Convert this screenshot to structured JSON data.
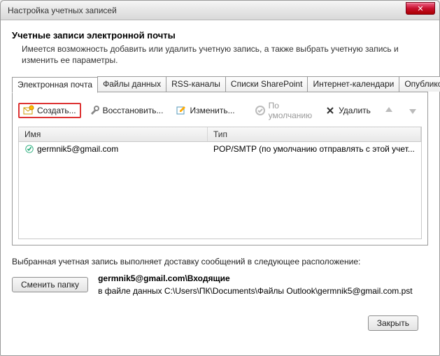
{
  "window": {
    "title": "Настройка учетных записей",
    "close": "✕"
  },
  "header": {
    "title": "Учетные записи электронной почты",
    "subtitle": "Имеется возможность добавить или удалить учетную запись, а также выбрать учетную запись и изменить ее параметры."
  },
  "tabs": [
    {
      "label": "Электронная почта",
      "active": true
    },
    {
      "label": "Файлы данных"
    },
    {
      "label": "RSS-каналы"
    },
    {
      "label": "Списки SharePoint"
    },
    {
      "label": "Интернет-календари"
    },
    {
      "label": "Опубликован"
    }
  ],
  "toolbar": {
    "create": "Создать...",
    "restore": "Восстановить...",
    "edit": "Изменить...",
    "default": "По умолчанию",
    "delete": "Удалить"
  },
  "columns": {
    "name": "Имя",
    "type": "Тип"
  },
  "rows": [
    {
      "name": "germnik5@gmail.com",
      "type": "POP/SMTP (по умолчанию отправлять с этой учет..."
    }
  ],
  "delivery": {
    "intro": "Выбранная учетная запись выполняет доставку сообщений в следующее расположение:",
    "change_btn": "Сменить папку",
    "path_bold": "germnik5@gmail.com\\Входящие",
    "path_file": "в файле данных C:\\Users\\ПК\\Documents\\Файлы Outlook\\germnik5@gmail.com.pst"
  },
  "buttons": {
    "close": "Закрыть"
  }
}
